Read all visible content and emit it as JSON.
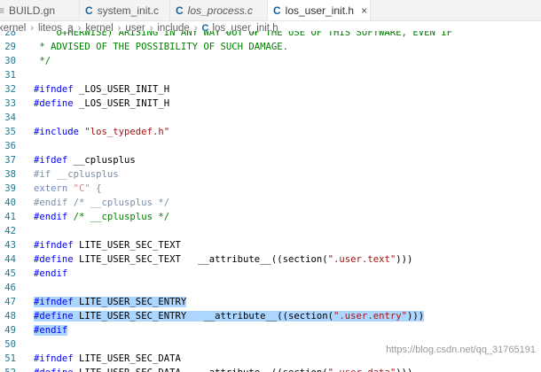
{
  "tabs": [
    {
      "label": "BUILD.gn",
      "icon": "gn-file-icon",
      "italic": false,
      "active": false
    },
    {
      "label": "system_init.c",
      "icon": "c-file-icon",
      "italic": false,
      "active": false
    },
    {
      "label": "los_process.c",
      "icon": "c-file-icon",
      "italic": true,
      "active": false
    },
    {
      "label": "los_user_init.h",
      "icon": "c-file-icon",
      "italic": false,
      "active": true
    }
  ],
  "icons": {
    "c_glyph": "C",
    "gn_glyph": "≡",
    "close_glyph": "×",
    "sep_glyph": "›"
  },
  "breadcrumb": [
    "kernel",
    "liteos_a",
    "kernel",
    "user",
    "include",
    "los_user_init.h"
  ],
  "watermark": "https://blog.csdn.net/qq_31765191",
  "lines": [
    {
      "num": "28",
      "segs": [
        {
          "t": "    OTHERWISE) ARISING IN ANY WAY OUT OF THE USE OF THIS SOFTWARE, EVEN IF",
          "c": "comment"
        }
      ]
    },
    {
      "num": "29",
      "segs": [
        {
          "t": " * ADVISED OF THE POSSIBILITY OF SUCH DAMAGE.",
          "c": "comment"
        }
      ]
    },
    {
      "num": "30",
      "segs": [
        {
          "t": " */",
          "c": "comment"
        }
      ]
    },
    {
      "num": "31",
      "segs": []
    },
    {
      "num": "32",
      "segs": [
        {
          "t": "#ifndef ",
          "c": "directive"
        },
        {
          "t": "_LOS_USER_INIT_H",
          "c": "plain"
        }
      ]
    },
    {
      "num": "33",
      "segs": [
        {
          "t": "#define ",
          "c": "directive"
        },
        {
          "t": "_LOS_USER_INIT_H",
          "c": "plain"
        }
      ]
    },
    {
      "num": "34",
      "segs": []
    },
    {
      "num": "35",
      "segs": [
        {
          "t": "#include ",
          "c": "directive"
        },
        {
          "t": "\"los_typedef.h\"",
          "c": "string"
        }
      ]
    },
    {
      "num": "36",
      "segs": []
    },
    {
      "num": "37",
      "segs": [
        {
          "t": "#ifdef ",
          "c": "directive"
        },
        {
          "t": "__cplusplus",
          "c": "plain"
        }
      ]
    },
    {
      "num": "38",
      "segs": [
        {
          "t": "#if __cplusplus",
          "c": "inactive"
        }
      ]
    },
    {
      "num": "39",
      "segs": [
        {
          "t": "extern ",
          "c": "inactive-kw"
        },
        {
          "t": "\"C\"",
          "c": "inactive-str"
        },
        {
          "t": " {",
          "c": "inactive"
        }
      ]
    },
    {
      "num": "40",
      "segs": [
        {
          "t": "#endif /* __cplusplus */",
          "c": "inactive"
        }
      ]
    },
    {
      "num": "41",
      "segs": [
        {
          "t": "#endif ",
          "c": "directive"
        },
        {
          "t": "/* __cplusplus */",
          "c": "comment"
        }
      ]
    },
    {
      "num": "42",
      "segs": []
    },
    {
      "num": "43",
      "segs": [
        {
          "t": "#ifndef ",
          "c": "directive"
        },
        {
          "t": "LITE_USER_SEC_TEXT",
          "c": "plain"
        }
      ]
    },
    {
      "num": "44",
      "segs": [
        {
          "t": "#define ",
          "c": "directive"
        },
        {
          "t": "LITE_USER_SEC_TEXT   __attribute__((section(",
          "c": "plain"
        },
        {
          "t": "\".user.text\"",
          "c": "string"
        },
        {
          "t": ")))",
          "c": "plain"
        }
      ]
    },
    {
      "num": "45",
      "segs": [
        {
          "t": "#endif",
          "c": "directive"
        }
      ]
    },
    {
      "num": "46",
      "segs": []
    },
    {
      "num": "47",
      "segs": [
        {
          "t": "#ifndef ",
          "c": "directive",
          "sel": true
        },
        {
          "t": "LITE_USER_SEC_ENTRY",
          "c": "plain",
          "sel": true
        }
      ]
    },
    {
      "num": "48",
      "segs": [
        {
          "t": "#define ",
          "c": "directive",
          "sel": true
        },
        {
          "t": "LITE_USER_SEC_ENTRY   __attribute__((section(",
          "c": "plain",
          "sel": true
        },
        {
          "t": "\".user.entry\"",
          "c": "string",
          "sel": true
        },
        {
          "t": ")))",
          "c": "plain",
          "sel": true
        }
      ]
    },
    {
      "num": "49",
      "segs": [
        {
          "t": "#endif",
          "c": "directive",
          "sel": true
        }
      ]
    },
    {
      "num": "50",
      "segs": []
    },
    {
      "num": "51",
      "segs": [
        {
          "t": "#ifndef ",
          "c": "directive"
        },
        {
          "t": "LITE_USER_SEC_DATA",
          "c": "plain"
        }
      ]
    },
    {
      "num": "52",
      "segs": [
        {
          "t": "#define ",
          "c": "directive"
        },
        {
          "t": "LITE_USER_SEC_DATA   __attribute__((section(",
          "c": "plain"
        },
        {
          "t": "\".user.data\"",
          "c": "string"
        },
        {
          "t": ")))",
          "c": "plain"
        }
      ]
    }
  ]
}
